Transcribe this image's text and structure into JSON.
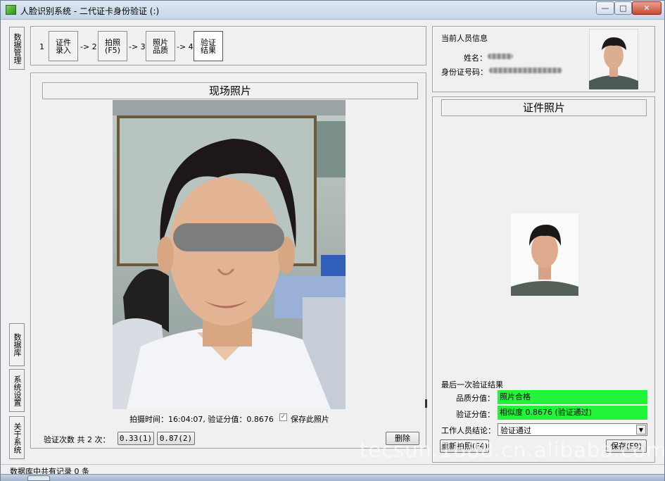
{
  "window": {
    "title": "人脸识别系统 - 二代证卡身份验证 (:)",
    "min_label": "—",
    "max_label": "□",
    "close_label": "✕"
  },
  "side_nav": {
    "data_mgmt": "数据管理",
    "database": "数据库",
    "settings": "系统设置",
    "about": "关于系统"
  },
  "steps": [
    {
      "num": "1",
      "label": "证件录入"
    },
    {
      "arrow": "-> 2",
      "label": "拍照(F5)"
    },
    {
      "arrow": "-> 3",
      "label": "照片品质"
    },
    {
      "arrow": "-> 4",
      "label": "验证结果"
    }
  ],
  "person_info": {
    "heading": "当前人员信息",
    "name_label": "姓名：",
    "id_label": "身份证号码："
  },
  "live_photo": {
    "caption": "现场照片",
    "footer": "拍摄时间：16:04:07, 验证分值：0.8676",
    "save_checkbox_label": "保存此照片",
    "save_checked": true
  },
  "verify_row": {
    "count_label": "验证次数 共 2 次：",
    "attempts": [
      "0.33(1)",
      "0.87(2)"
    ],
    "delete_label": "删除"
  },
  "id_photo": {
    "caption": "证件照片"
  },
  "result": {
    "heading": "最后一次验证结果",
    "quality_label": "品质分值：",
    "quality_value": "照片合格",
    "score_label": "验证分值：",
    "score_value": "相似度 0.8676 (验证通过)",
    "conclusion_label": "工作人员结论：",
    "conclusion_value": "验证通过",
    "retake_label": "重新拍照(F4)",
    "save_label": "保存(F9)",
    "field_color": "#22f43a"
  },
  "status_bar": {
    "text": "数据库中共有记录 0 条"
  },
  "watermark": "tecsun.1688.cn.alibaba.com"
}
